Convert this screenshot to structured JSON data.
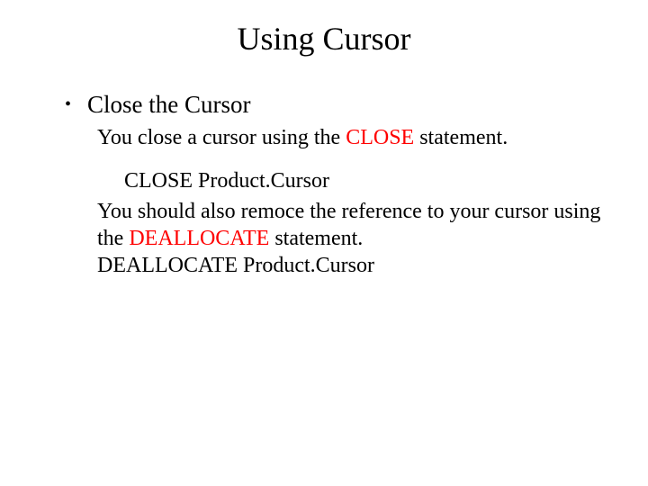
{
  "title": "Using Cursor",
  "bullet": "Close the Cursor",
  "line1_a": "You close a cursor using the ",
  "line1_b": "CLOSE",
  "line1_c": " statement.",
  "code1": "CLOSE Product.Cursor",
  "line2_a": "You should also remoce the reference to your cursor using the ",
  "line2_b": "DEALLOCATE",
  "line2_c": " statement.",
  "line3": "DEALLOCATE Product.Cursor"
}
